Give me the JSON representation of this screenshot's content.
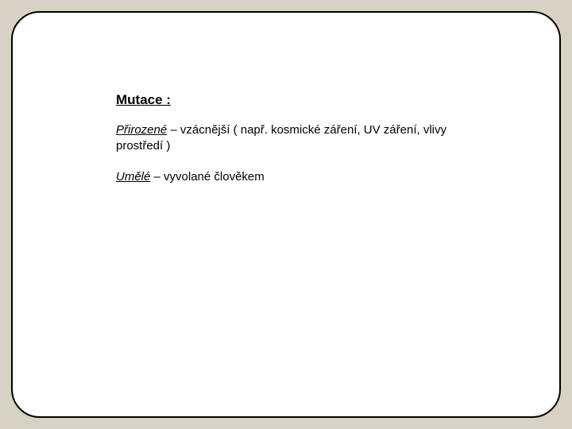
{
  "slide": {
    "heading": "Mutace :",
    "p1_lead": "Přirozené",
    "p1_rest": " – vzácnější ( např. kosmické záření, UV záření, vlivy prostředí )",
    "p2_lead": "Umělé",
    "p2_rest": " – vyvolané člověkem"
  }
}
